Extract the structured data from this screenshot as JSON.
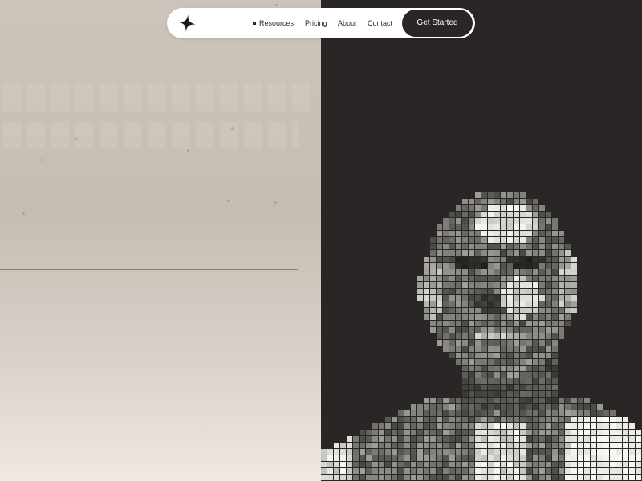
{
  "nav": {
    "logo_icon": "four-point-star-icon",
    "bullet_icon": "square-bullet-icon",
    "links": [
      {
        "label": "Resources"
      },
      {
        "label": "Pricing"
      },
      {
        "label": "About"
      },
      {
        "label": "Contact"
      }
    ],
    "cta_label": "Get Started"
  },
  "hero": {
    "portrait_style": "pixel-mosaic-grayscale",
    "colors": {
      "left_bg_top": "#ccc4ba",
      "left_bg_bottom": "#efe8e3",
      "right_bg": "#2a2625",
      "divider": "#8c7f74",
      "cta_bg": "#2a2625",
      "cta_text": "#ffffff",
      "nav_bg": "#ffffff"
    }
  }
}
